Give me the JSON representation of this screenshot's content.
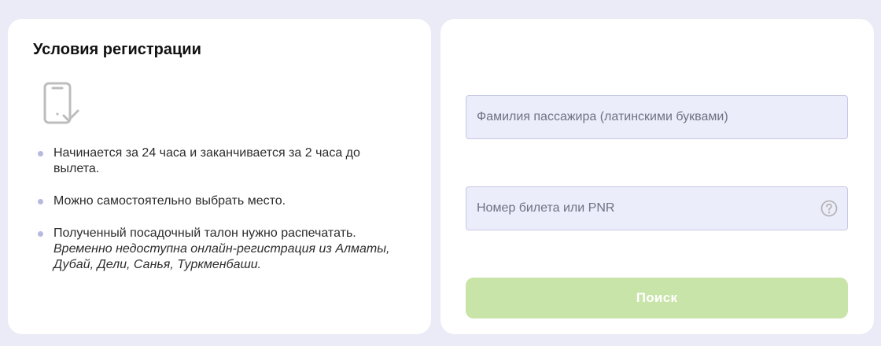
{
  "conditions": {
    "title": "Условия регистрации",
    "icon": "phone-check-icon",
    "items": [
      {
        "text": "Начинается за 24 часа и заканчивается за 2 часа до вылета."
      },
      {
        "text": "Можно самостоятельно выбрать место."
      },
      {
        "text": "Полученный посадочный талон нужно распечатать.",
        "note": "Временно недоступна онлайн-регистрация из Алматы, Дубай, Дели, Санья, Туркменбаши."
      }
    ]
  },
  "form": {
    "surname_placeholder": "Фамилия пассажира (латинскими буквами)",
    "surname_value": "",
    "ticket_placeholder": "Номер билета или PNR",
    "ticket_value": "",
    "help_icon": "question-circle-icon",
    "search_label": "Поиск"
  },
  "colors": {
    "page_background": "#eaebf6",
    "input_background": "#ecedfa",
    "button_background": "#c9e4a8",
    "bullet_dot": "#b7b9df"
  }
}
